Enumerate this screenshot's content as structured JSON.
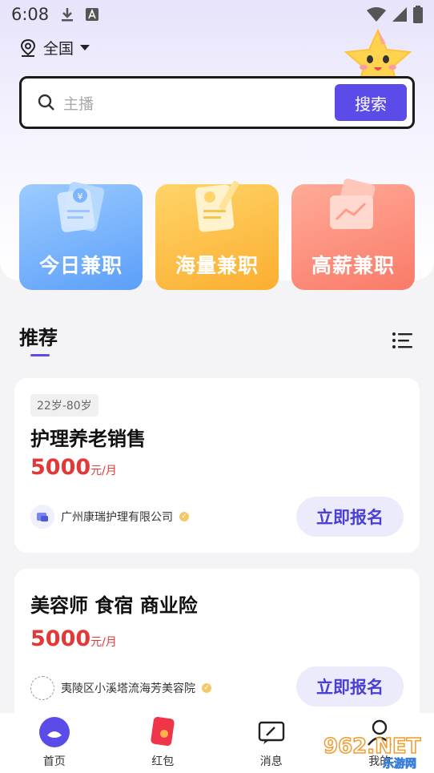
{
  "status_bar": {
    "time": "6:08"
  },
  "location": {
    "label": "全国"
  },
  "search": {
    "placeholder": "主播",
    "button_label": "搜索"
  },
  "categories": [
    {
      "label": "今日兼职",
      "color_top": "#8fc4ff",
      "color_bottom": "#5fa3fb"
    },
    {
      "label": "海量兼职",
      "color_top": "#ffd264",
      "color_bottom": "#fbb33a"
    },
    {
      "label": "高薪兼职",
      "color_top": "#ffa792",
      "color_bottom": "#fb7f6a"
    }
  ],
  "section": {
    "title": "推荐"
  },
  "jobs": [
    {
      "age_range": "22岁-80岁",
      "title": "护理养老销售",
      "salary": "5000",
      "salary_unit": "元/月",
      "company": "广州康瑞护理有限公司",
      "apply_label": "立即报名"
    },
    {
      "title": "美容师 食宿 商业险",
      "salary": "5000",
      "salary_unit": "元/月",
      "company": "夷陵区小溪塔流海芳美容院",
      "apply_label": "立即报名"
    }
  ],
  "tab_bar": {
    "tabs": [
      {
        "label": "首页",
        "icon": "home-icon"
      },
      {
        "label": "红包",
        "icon": "red-packet-icon"
      },
      {
        "label": "消息",
        "icon": "message-icon"
      },
      {
        "label": "我的",
        "icon": "profile-icon"
      }
    ]
  },
  "watermark": {
    "text": "962.NET",
    "sub": "乐游网"
  },
  "colors": {
    "accent": "#5b4be8",
    "salary": "#e23838"
  }
}
